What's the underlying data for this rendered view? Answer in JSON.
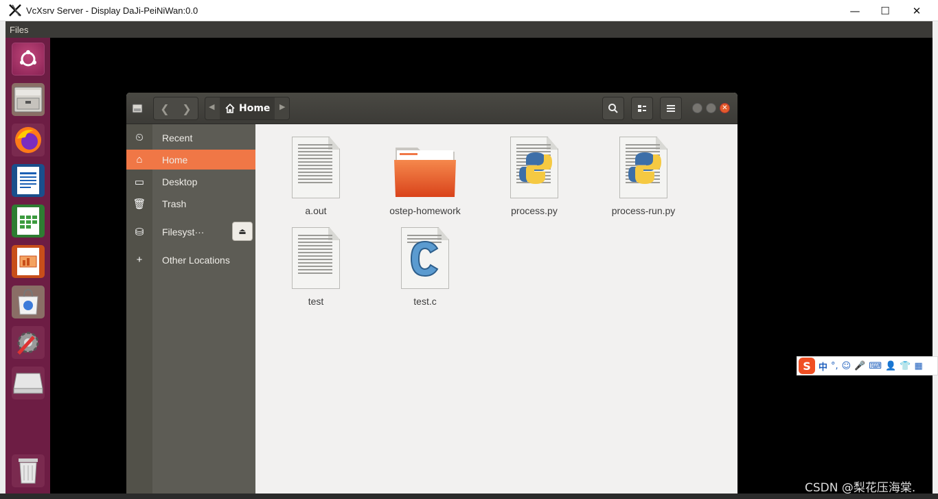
{
  "host_window": {
    "title": "VcXsrv Server - Display DaJi-PeiNiWan:0.0",
    "min_symbol": "—",
    "max_symbol": "☐",
    "close_symbol": "✕"
  },
  "top_panel": {
    "label": "Files"
  },
  "launcher": {
    "items": [
      {
        "name": "ubuntu-dash-icon"
      },
      {
        "name": "files-icon"
      },
      {
        "name": "firefox-icon"
      },
      {
        "name": "writer-icon"
      },
      {
        "name": "calc-icon"
      },
      {
        "name": "impress-icon"
      },
      {
        "name": "software-center-icon"
      },
      {
        "name": "system-settings-icon"
      },
      {
        "name": "drive-icon"
      },
      {
        "name": "trash-icon"
      }
    ]
  },
  "nautilus": {
    "breadcrumb_home": "Home",
    "sidebar": [
      {
        "label": "Recent",
        "icon": "⏲"
      },
      {
        "label": "Home",
        "icon": "⌂"
      },
      {
        "label": "Desktop",
        "icon": "▭"
      },
      {
        "label": "Trash",
        "icon": "🗑"
      },
      {
        "label": "Filesyst···",
        "icon": "⛁"
      },
      {
        "label": "Other Locations",
        "icon": "+"
      }
    ],
    "files": [
      {
        "name": "a.out",
        "type": "text-document"
      },
      {
        "name": "ostep-homework",
        "type": "folder"
      },
      {
        "name": "process.py",
        "type": "python"
      },
      {
        "name": "process-run.py",
        "type": "python"
      },
      {
        "name": "test",
        "type": "text-document"
      },
      {
        "name": "test.c",
        "type": "c-source"
      }
    ]
  },
  "ime": {
    "logo": "S",
    "mode": "中"
  },
  "watermark": "CSDN @梨花压海棠."
}
